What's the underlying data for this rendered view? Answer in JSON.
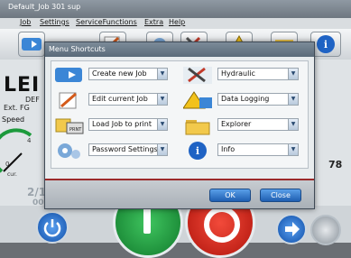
{
  "window": {
    "title": "Default_Job 301 sup"
  },
  "menu": [
    {
      "label": "Job"
    },
    {
      "label": "Settings"
    },
    {
      "label": "ServiceFunctions"
    },
    {
      "label": "Extra"
    },
    {
      "label": "Help"
    }
  ],
  "background": {
    "brand": "LEI",
    "brand_sub1": "DEF",
    "brand_sub2": "Ext. FG",
    "speed_label": "Speed",
    "gauge_labels": [
      "4",
      "0",
      "cur."
    ],
    "right_value": "78",
    "date_partial": "2/1",
    "date_partial2": "00"
  },
  "dialog": {
    "title": "Menu Shortcuts",
    "shortcuts_left": [
      {
        "label": "Create new Job",
        "icon": "create-job-icon"
      },
      {
        "label": "Edit current Job",
        "icon": "edit-job-icon"
      },
      {
        "label": "Load Job to print",
        "icon": "load-job-icon"
      },
      {
        "label": "Password Settings",
        "icon": "password-settings-icon"
      }
    ],
    "shortcuts_right": [
      {
        "label": "Hydraulic",
        "icon": "hydraulic-icon"
      },
      {
        "label": "Data Logging",
        "icon": "data-logging-icon"
      },
      {
        "label": "Explorer",
        "icon": "folder-icon"
      },
      {
        "label": "Info",
        "icon": "info-icon"
      }
    ],
    "ok_label": "OK",
    "close_label": "Close"
  },
  "colors": {
    "accent": "#1f5fb2",
    "stop_red": "#d9241c",
    "go_green": "#1f9a3c"
  }
}
